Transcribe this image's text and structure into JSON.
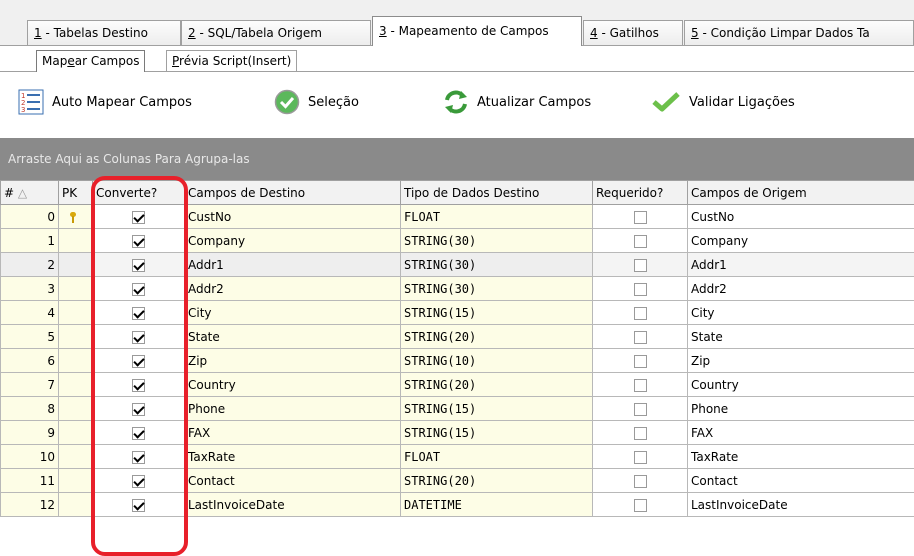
{
  "main_tabs": [
    {
      "key": "1",
      "label": " - Tabelas Destino"
    },
    {
      "key": "2",
      "label": " - SQL/Tabela Origem"
    },
    {
      "key": "3",
      "label": " - Mapeamento de Campos"
    },
    {
      "key": "4",
      "label": " - Gatilhos"
    },
    {
      "key": "5",
      "label": " - Condição Limpar Dados Ta"
    }
  ],
  "sub_tabs": [
    {
      "pre": "Map",
      "hot": "e",
      "post": "ar Campos"
    },
    {
      "pre": "",
      "hot": "P",
      "post": "révia Script(Insert)"
    }
  ],
  "toolbar": {
    "auto_map": "Auto Mapear Campos",
    "selection": "Seleção",
    "update_fields": "Atualizar Campos",
    "validate": "Validar Ligações"
  },
  "group_panel_text": "Arraste Aqui as Colunas Para Agrupa-las",
  "columns": {
    "num": "#",
    "sort_indicator": "△",
    "pk": "PK",
    "convert": "Converte?",
    "dest_field": "Campos de Destino",
    "dest_type": "Tipo de Dados Destino",
    "required": "Requerido?",
    "source_field": "Campos de Origem"
  },
  "rows": [
    {
      "n": "0",
      "pk": true,
      "convert": true,
      "dest": "CustNo",
      "type": "FLOAT",
      "required": false,
      "source": "CustNo"
    },
    {
      "n": "1",
      "pk": false,
      "convert": true,
      "dest": "Company",
      "type": "STRING(30)",
      "required": false,
      "source": "Company"
    },
    {
      "n": "2",
      "pk": false,
      "convert": true,
      "dest": "Addr1",
      "type": "STRING(30)",
      "required": false,
      "source": "Addr1"
    },
    {
      "n": "3",
      "pk": false,
      "convert": true,
      "dest": "Addr2",
      "type": "STRING(30)",
      "required": false,
      "source": "Addr2"
    },
    {
      "n": "4",
      "pk": false,
      "convert": true,
      "dest": "City",
      "type": "STRING(15)",
      "required": false,
      "source": "City"
    },
    {
      "n": "5",
      "pk": false,
      "convert": true,
      "dest": "State",
      "type": "STRING(20)",
      "required": false,
      "source": "State"
    },
    {
      "n": "6",
      "pk": false,
      "convert": true,
      "dest": "Zip",
      "type": "STRING(10)",
      "required": false,
      "source": "Zip"
    },
    {
      "n": "7",
      "pk": false,
      "convert": true,
      "dest": "Country",
      "type": "STRING(20)",
      "required": false,
      "source": "Country"
    },
    {
      "n": "8",
      "pk": false,
      "convert": true,
      "dest": "Phone",
      "type": "STRING(15)",
      "required": false,
      "source": "Phone"
    },
    {
      "n": "9",
      "pk": false,
      "convert": true,
      "dest": "FAX",
      "type": "STRING(15)",
      "required": false,
      "source": "FAX"
    },
    {
      "n": "10",
      "pk": false,
      "convert": true,
      "dest": "TaxRate",
      "type": "FLOAT",
      "required": false,
      "source": "TaxRate"
    },
    {
      "n": "11",
      "pk": false,
      "convert": true,
      "dest": "Contact",
      "type": "STRING(20)",
      "required": false,
      "source": "Contact"
    },
    {
      "n": "12",
      "pk": false,
      "convert": true,
      "dest": "LastInvoiceDate",
      "type": "DATETIME",
      "required": false,
      "source": "LastInvoiceDate"
    }
  ],
  "selected_row": "2",
  "colors": {
    "row_background": "#fdfde6",
    "group_panel": "#8a8a8a",
    "highlight_border": "#e8202a"
  },
  "icons": {
    "auto_map": "numbered-list-icon",
    "selection": "green-check-circle-icon",
    "update_fields": "green-refresh-arrows-icon",
    "validate": "green-checkmark-icon",
    "pk": "key-icon"
  }
}
